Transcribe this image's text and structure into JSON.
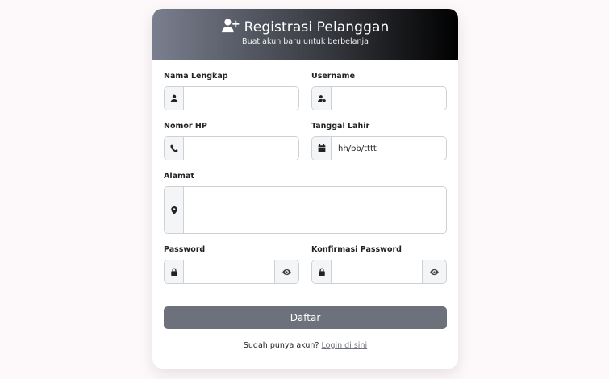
{
  "header": {
    "title": "Registrasi Pelanggan",
    "subtitle": "Buat akun baru untuk berbelanja",
    "icon": "user-plus-icon"
  },
  "fields": {
    "nama_lengkap": {
      "label": "Nama Lengkap",
      "value": "",
      "placeholder": "",
      "icon": "user-icon"
    },
    "username": {
      "label": "Username",
      "value": "",
      "placeholder": "",
      "icon": "user-tag-icon"
    },
    "nomor_hp": {
      "label": "Nomor HP",
      "value": "",
      "placeholder": "",
      "icon": "phone-icon"
    },
    "tanggal_lahir": {
      "label": "Tanggal Lahir",
      "value": "",
      "placeholder": "hh/bb/tttt",
      "icon": "calendar-icon"
    },
    "alamat": {
      "label": "Alamat",
      "value": "",
      "placeholder": "",
      "icon": "map-marker-icon"
    },
    "password": {
      "label": "Password",
      "value": "",
      "placeholder": "",
      "icon": "lock-icon",
      "toggle_icon": "eye-icon"
    },
    "konfirmasi_password": {
      "label": "Konfirmasi Password",
      "value": "",
      "placeholder": "",
      "icon": "lock-icon",
      "toggle_icon": "eye-icon"
    }
  },
  "submit": {
    "label": "Daftar"
  },
  "footer": {
    "text": "Sudah punya akun?",
    "link_label": "Login di sini"
  },
  "colors": {
    "background": "#fdf8fa",
    "header_gradient_start": "#7a7f8f",
    "header_gradient_end": "#000000",
    "button": "#6c717c"
  }
}
